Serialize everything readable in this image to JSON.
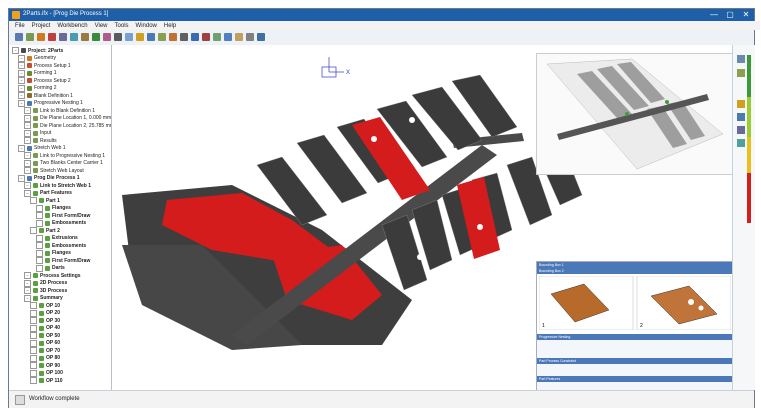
{
  "window": {
    "title": "2Parts.ifx - [Prog Die Process 1]",
    "controls": [
      "—",
      "▢",
      "✕"
    ]
  },
  "menu": [
    "File",
    "Project",
    "Workbench",
    "View",
    "Tools",
    "Window",
    "Help"
  ],
  "tree": [
    {
      "label": "Project: 2Parts",
      "level": 0,
      "bold": true,
      "color": "#4a4a4a"
    },
    {
      "label": "Geometry",
      "level": 1,
      "color": "#d07a20"
    },
    {
      "label": "Process Setup 1",
      "level": 1,
      "color": "#c05030"
    },
    {
      "label": "Forming 1",
      "level": 1,
      "color": "#6a8a30"
    },
    {
      "label": "Process Setup 2",
      "level": 1,
      "color": "#c05030"
    },
    {
      "label": "Forming 2",
      "level": 1,
      "color": "#6a8a30"
    },
    {
      "label": "Blank Definition 1",
      "level": 1,
      "color": "#8a6a30"
    },
    {
      "label": "Progressive Nesting 1",
      "level": 1,
      "color": "#4a7ab0"
    },
    {
      "label": "Link to Blank Definition 1",
      "level": 2,
      "color": "#7a9a50"
    },
    {
      "label": "Die Plane Location 1, 0.000 mm",
      "level": 2,
      "color": "#7a9a50"
    },
    {
      "label": "Die Plane Location 2, 25.785 mm",
      "level": 2,
      "color": "#7a9a50"
    },
    {
      "label": "Input",
      "level": 2,
      "color": "#7a9a50"
    },
    {
      "label": "Results",
      "level": 2,
      "color": "#7a9a50"
    },
    {
      "label": "Stretch Web 1",
      "level": 1,
      "color": "#4a7ab0"
    },
    {
      "label": "Link to Progressive Nesting 1",
      "level": 2,
      "color": "#7a9a50"
    },
    {
      "label": "Two Blanks Center Carrier 1",
      "level": 2,
      "color": "#7a9a50"
    },
    {
      "label": "Stretch Web Layout",
      "level": 2,
      "color": "#7a9a50"
    },
    {
      "label": "Prog Die Process 1",
      "level": 1,
      "bold": true,
      "color": "#4a7ab0"
    },
    {
      "label": "Link to Stretch Web 1",
      "level": 2,
      "bold": true,
      "color": "#5aa040"
    },
    {
      "label": "Part Features",
      "level": 2,
      "bold": true,
      "color": "#5aa040"
    },
    {
      "label": "Part 1",
      "level": 3,
      "bold": true,
      "color": "#5aa040"
    },
    {
      "label": "Flanges",
      "level": 4,
      "bold": true,
      "color": "#5aa040"
    },
    {
      "label": "First Form/Draw",
      "level": 4,
      "bold": true,
      "color": "#5aa040"
    },
    {
      "label": "Embossments",
      "level": 4,
      "bold": true,
      "color": "#5aa040"
    },
    {
      "label": "Part 2",
      "level": 3,
      "bold": true,
      "color": "#5aa040"
    },
    {
      "label": "Extrusions",
      "level": 4,
      "bold": true,
      "color": "#5aa040"
    },
    {
      "label": "Embossments",
      "level": 4,
      "bold": true,
      "color": "#5aa040"
    },
    {
      "label": "Flanges",
      "level": 4,
      "bold": true,
      "color": "#5aa040"
    },
    {
      "label": "First Form/Draw",
      "level": 4,
      "bold": true,
      "color": "#5aa040"
    },
    {
      "label": "Darts",
      "level": 4,
      "bold": true,
      "color": "#5aa040"
    },
    {
      "label": "Process Settings",
      "level": 2,
      "bold": true,
      "color": "#5aa040"
    },
    {
      "label": "2D Process",
      "level": 2,
      "bold": true,
      "color": "#5aa040"
    },
    {
      "label": "3D Process",
      "level": 2,
      "bold": true,
      "color": "#5aa040"
    },
    {
      "label": "Summary",
      "level": 2,
      "bold": true,
      "color": "#5aa040"
    },
    {
      "label": "OP 10",
      "level": 3,
      "bold": true,
      "color": "#5aa040"
    },
    {
      "label": "OP 20",
      "level": 3,
      "bold": true,
      "color": "#5aa040"
    },
    {
      "label": "OP 30",
      "level": 3,
      "bold": true,
      "color": "#5aa040"
    },
    {
      "label": "OP 40",
      "level": 3,
      "bold": true,
      "color": "#5aa040"
    },
    {
      "label": "OP 50",
      "level": 3,
      "bold": true,
      "color": "#5aa040"
    },
    {
      "label": "OP 60",
      "level": 3,
      "bold": true,
      "color": "#5aa040"
    },
    {
      "label": "OP 70",
      "level": 3,
      "bold": true,
      "color": "#5aa040"
    },
    {
      "label": "OP 80",
      "level": 3,
      "bold": true,
      "color": "#5aa040"
    },
    {
      "label": "OP 90",
      "level": 3,
      "bold": true,
      "color": "#5aa040"
    },
    {
      "label": "OP 100",
      "level": 3,
      "bold": true,
      "color": "#5aa040"
    },
    {
      "label": "OP 110",
      "level": 3,
      "bold": true,
      "color": "#5aa040"
    }
  ],
  "viewport": {
    "axis_label": "X",
    "palette": {
      "part": "#3a3a3a",
      "highlight": "#d41c1c",
      "carrier": "#4a4a4a",
      "background": "#ffffff"
    }
  },
  "report": {
    "sections": [
      "Bounding Box 1",
      "Bounding Box 2"
    ],
    "thumb_labels": [
      "1",
      "2"
    ],
    "tables": [
      "Progressive Nesting",
      "Part Process Constraint",
      "Part Features"
    ]
  },
  "rightbar": {
    "colors": [
      "#3a9a3a",
      "#9acd32",
      "#e8c020",
      "#d02020"
    ]
  },
  "status": {
    "text": "Workflow complete"
  }
}
